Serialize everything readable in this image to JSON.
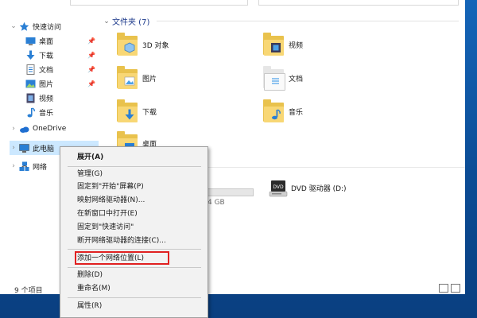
{
  "nav": {
    "quick_access": "快速访问",
    "items": [
      {
        "label": "桌面",
        "pinned": true,
        "icon": "desktop-icon"
      },
      {
        "label": "下载",
        "pinned": true,
        "icon": "download-icon"
      },
      {
        "label": "文档",
        "pinned": true,
        "icon": "document-icon"
      },
      {
        "label": "图片",
        "pinned": true,
        "icon": "picture-icon"
      },
      {
        "label": "视频",
        "pinned": false,
        "icon": "video-icon"
      },
      {
        "label": "音乐",
        "pinned": false,
        "icon": "music-icon"
      }
    ],
    "onedrive": "OneDrive",
    "this_pc": "此电脑",
    "network": "网络",
    "pin_glyph": "📌"
  },
  "main": {
    "section_title": "文件夹 (7)",
    "folders": [
      {
        "label": "3D 对象",
        "icon": "3d-objects-folder-icon"
      },
      {
        "label": "视频",
        "icon": "videos-folder-icon"
      },
      {
        "label": "图片",
        "icon": "pictures-folder-icon"
      },
      {
        "label": "文档",
        "icon": "documents-folder-icon"
      },
      {
        "label": "下载",
        "icon": "downloads-folder-icon"
      },
      {
        "label": "音乐",
        "icon": "music-folder-icon"
      },
      {
        "label": "桌面",
        "icon": "desktop-folder-icon"
      }
    ],
    "drive_size_partial": "4 GB",
    "dvd_label": "DVD 驱动器 (D:)",
    "dvd_badge": "DVD"
  },
  "status": {
    "item_count": "9 个项目"
  },
  "context_menu": {
    "items": [
      "展开(A)",
      "管理(G)",
      "固定到\"开始\"屏幕(P)",
      "映射网络驱动器(N)...",
      "在新窗口中打开(E)",
      "固定到\"快速访问\"",
      "断开网络驱动器的连接(C)...",
      "添加一个网络位置(L)",
      "删除(D)",
      "重命名(M)",
      "属性(R)"
    ],
    "highlighted_index": 7
  },
  "colors": {
    "accent": "#1e3b8c",
    "selection": "#cce8ff",
    "highlight_box": "#e02020",
    "folder": "#f8d775"
  }
}
